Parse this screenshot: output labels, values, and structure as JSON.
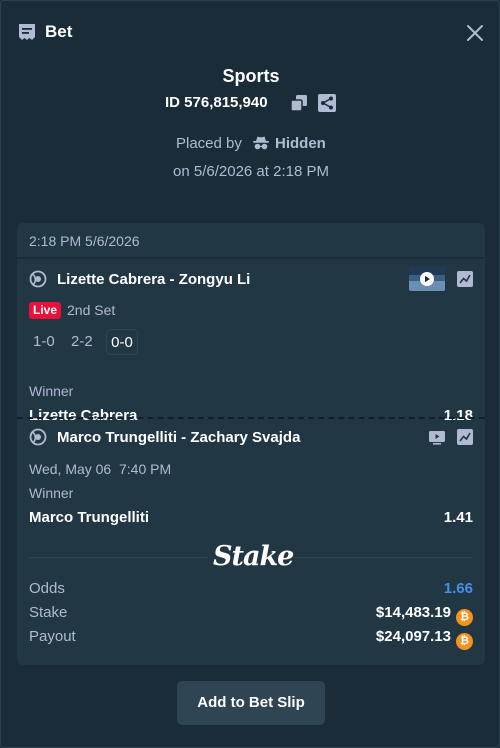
{
  "header": {
    "title": "Bet"
  },
  "summary": {
    "sport": "Sports",
    "id_label": "ID",
    "id_value": "576,815,940",
    "placed_by_label": "Placed by",
    "placed_by_user": "Hidden",
    "placed_on": "on 5/6/2026 at 2:18 PM"
  },
  "card": {
    "timestamp": "2:18 PM 5/6/2026",
    "legs": [
      {
        "match": "Lizette Cabrera - Zongyu Li",
        "status_badge": "Live",
        "period": "2nd Set",
        "scores": [
          "1-0",
          "2-2",
          "0-0"
        ],
        "market": "Winner",
        "selection": "Lizette Cabrera",
        "odds": "1.18"
      },
      {
        "match": "Marco Trungelliti - Zachary Svajda",
        "date": "Wed, May 06  7:40 PM",
        "market": "Winner",
        "selection": "Marco Trungelliti",
        "odds": "1.41"
      }
    ],
    "brand": "Stake",
    "totals": {
      "odds_label": "Odds",
      "odds_value": "1.66",
      "stake_label": "Stake",
      "stake_value": "$14,483.19",
      "payout_label": "Payout",
      "payout_value": "$24,097.13",
      "currency_glyph": "₿"
    }
  },
  "actions": {
    "add_to_slip": "Add to Bet Slip"
  },
  "colors": {
    "background": "#1a2c38",
    "card": "#213743",
    "muted_text": "#b1bad3",
    "accent_blue": "#4391e7",
    "live_red": "#e9113c",
    "btc_orange": "#f7931a"
  },
  "icons": {
    "header": "bet-slip-icon",
    "close": "close-icon",
    "copy": "copy-icon",
    "share": "share-icon",
    "placed_by": "incognito-icon",
    "sport": "tennis-ball-icon",
    "stats": "stats-chart-icon",
    "stream": "live-stream-icon",
    "tv": "tv-icon",
    "currency": "bitcoin-icon"
  }
}
